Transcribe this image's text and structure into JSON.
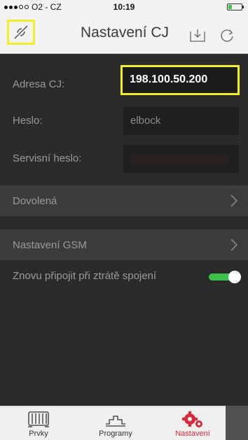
{
  "status_bar": {
    "carrier": "O2 - CZ",
    "time": "10:19"
  },
  "header": {
    "title": "Nastavení CJ"
  },
  "icons": {
    "disconnect": "plug-disconnect-icon",
    "download": "download-icon",
    "refresh": "refresh-icon",
    "chevron": "chevron-right-icon"
  },
  "form": {
    "address_label": "Adresa CJ:",
    "address_value": "198.100.50.200",
    "password_label": "Heslo:",
    "password_value": "elbock",
    "service_password_label": "Servisní heslo:",
    "service_password_value": ""
  },
  "menu": {
    "vacation_label": "Dovolená",
    "gsm_label": "Nastavení GSM"
  },
  "reconnect": {
    "label": "Znovu připojit při ztrátě spojení",
    "enabled": true
  },
  "tabs": [
    {
      "label": "Prvky",
      "icon": "radiator-icon"
    },
    {
      "label": "Programy",
      "icon": "program-graph-icon"
    },
    {
      "label": "Nastavení",
      "icon": "gears-icon",
      "active": true
    }
  ],
  "colors": {
    "highlight": "#f4ec24",
    "accent_red": "#d8283a",
    "toggle_on": "#3cc24a",
    "background": "#2b2b2b"
  }
}
